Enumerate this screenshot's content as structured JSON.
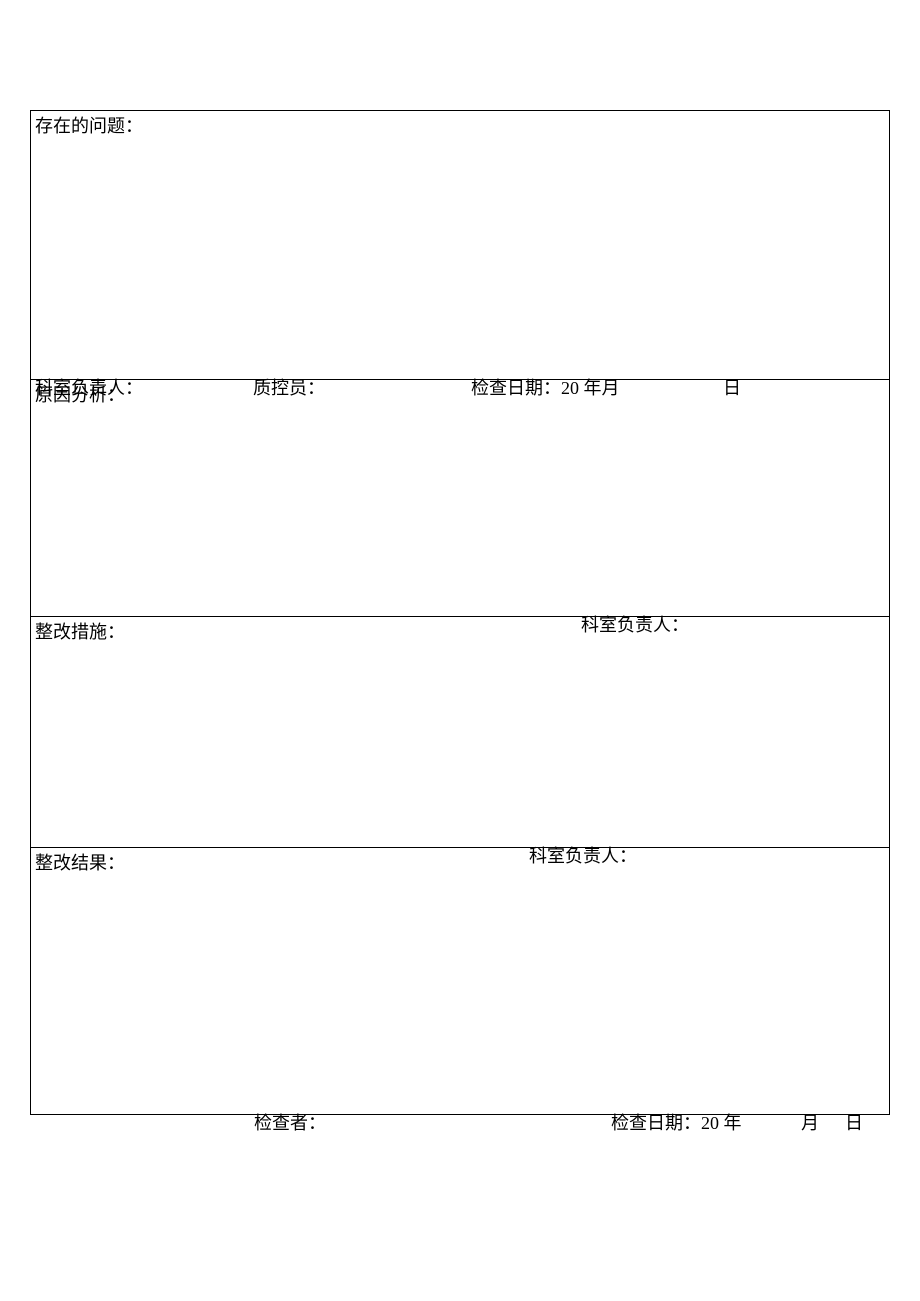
{
  "sections": {
    "problems": {
      "label": "存在的问题："
    },
    "analysis": {
      "label": "原因分析："
    },
    "measures": {
      "label": "整改措施："
    },
    "result": {
      "label": "整改结果："
    }
  },
  "signatures": {
    "deptHead": "科室负责人：",
    "qc": "质控员：",
    "inspector": "检查者：",
    "checkDateLabel": "检查日期：",
    "yearPrefix": "20",
    "year": "年",
    "month": "月",
    "day": "日"
  }
}
